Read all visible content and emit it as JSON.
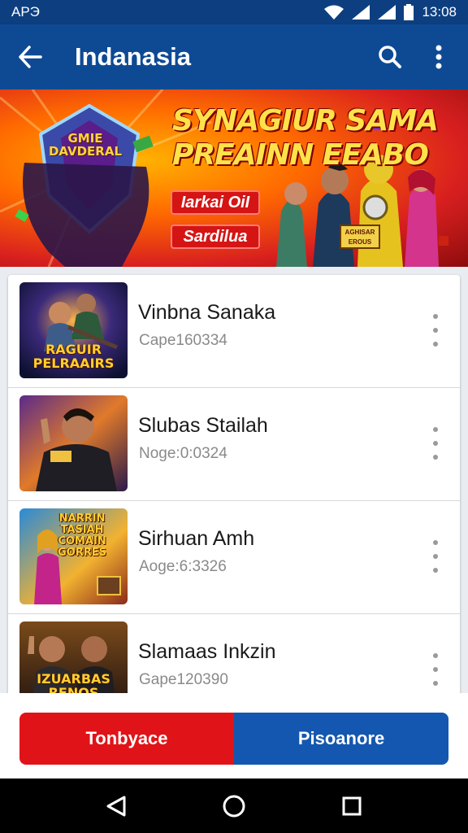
{
  "status_bar": {
    "left_text": "APЭ",
    "time": "13:08",
    "icons": [
      "wifi-icon",
      "signal-icon",
      "signal-icon",
      "battery-icon"
    ]
  },
  "app_bar": {
    "title": "Indanasia",
    "icons": [
      "back-arrow-icon",
      "search-icon",
      "more-vert-icon"
    ]
  },
  "banner": {
    "headline_line1": "SYNAGIUR SAMA",
    "headline_line2": "PREAINN EEABO",
    "tag1": "Iarkai OiI",
    "tag2": "Sardilua",
    "logo_text": "GMIE DAVDERAL",
    "badge_text": "AGHISAR EROUS"
  },
  "list": {
    "items": [
      {
        "title": "Vinbna Sanaka",
        "subtitle": "Cape160334",
        "thumb_text": "RAGUIR PELRAAIRS"
      },
      {
        "title": "Slubas Stailah",
        "subtitle": "Noge:0:0324",
        "thumb_text": ""
      },
      {
        "title": "Sirhuan Amh",
        "subtitle": "Aoge:6:3326",
        "thumb_text": "NARRIN TASIAH COMAIN GORRES"
      },
      {
        "title": "Slamaas Inkzin",
        "subtitle": "Gape120390",
        "thumb_text": "IZUARBAS RENOS"
      }
    ]
  },
  "actions": {
    "left_label": "Tonbyace",
    "right_label": "Pisoanore"
  },
  "colors": {
    "app_bar": "#0e4a94",
    "status_bar": "#0d3f80",
    "left_button": "#e01418",
    "right_button": "#1457b0"
  },
  "nav": {
    "icons": [
      "back-triangle-icon",
      "home-circle-icon",
      "recents-square-icon"
    ]
  }
}
